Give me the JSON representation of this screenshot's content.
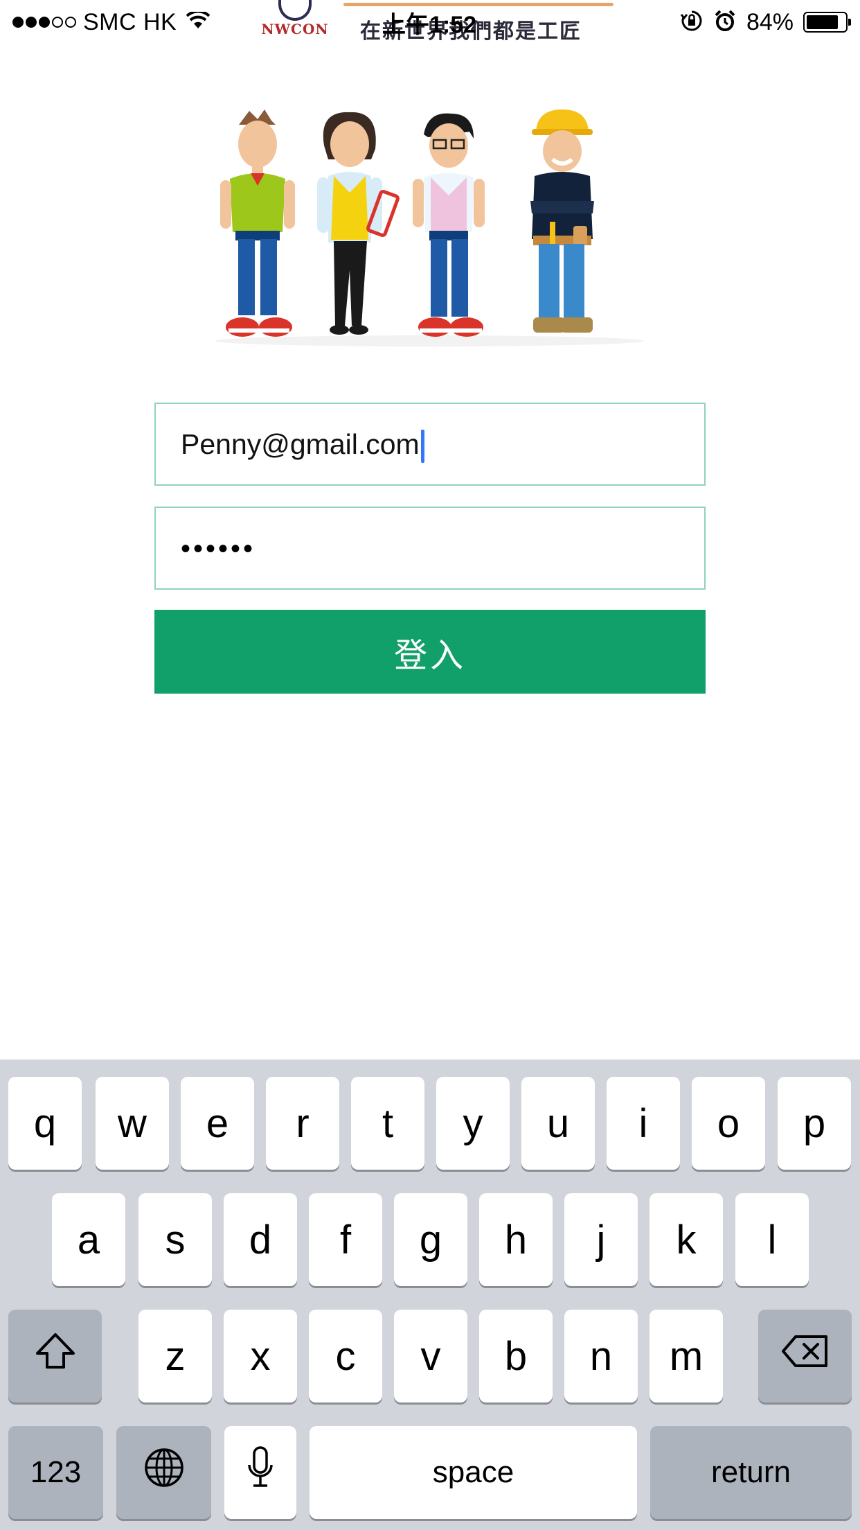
{
  "status_bar": {
    "carrier": "SMC HK",
    "time": "上午1:52",
    "battery_percent": "84%",
    "battery_level": 0.84,
    "signal_bars_filled": 3,
    "signal_bars_total": 5,
    "icons": [
      "wifi-icon",
      "rotation-lock-icon",
      "alarm-icon",
      "battery-icon"
    ]
  },
  "banner": {
    "logo_text": "NWCON",
    "slogan": "在新世界我們都是工匠",
    "colors": {
      "logo": "#b22a2a",
      "slogan_line": "#e7a668"
    }
  },
  "illustration": {
    "icon": "four-workers-illustration"
  },
  "login_form": {
    "email_value": "Penny@gmail.com",
    "password_value": "••••••",
    "login_label": "登入",
    "colors": {
      "accent": "#12a06a",
      "field_border": "#8fd4b5",
      "caret": "#3478f6"
    }
  },
  "keyboard": {
    "row1": [
      "q",
      "w",
      "e",
      "r",
      "t",
      "y",
      "u",
      "i",
      "o",
      "p"
    ],
    "row2": [
      "a",
      "s",
      "d",
      "f",
      "g",
      "h",
      "j",
      "k",
      "l"
    ],
    "row3": [
      "z",
      "x",
      "c",
      "v",
      "b",
      "n",
      "m"
    ],
    "numbers_label": "123",
    "space_label": "space",
    "return_label": "return",
    "icons": [
      "shift-icon",
      "backspace-icon",
      "globe-icon",
      "microphone-icon"
    ]
  }
}
